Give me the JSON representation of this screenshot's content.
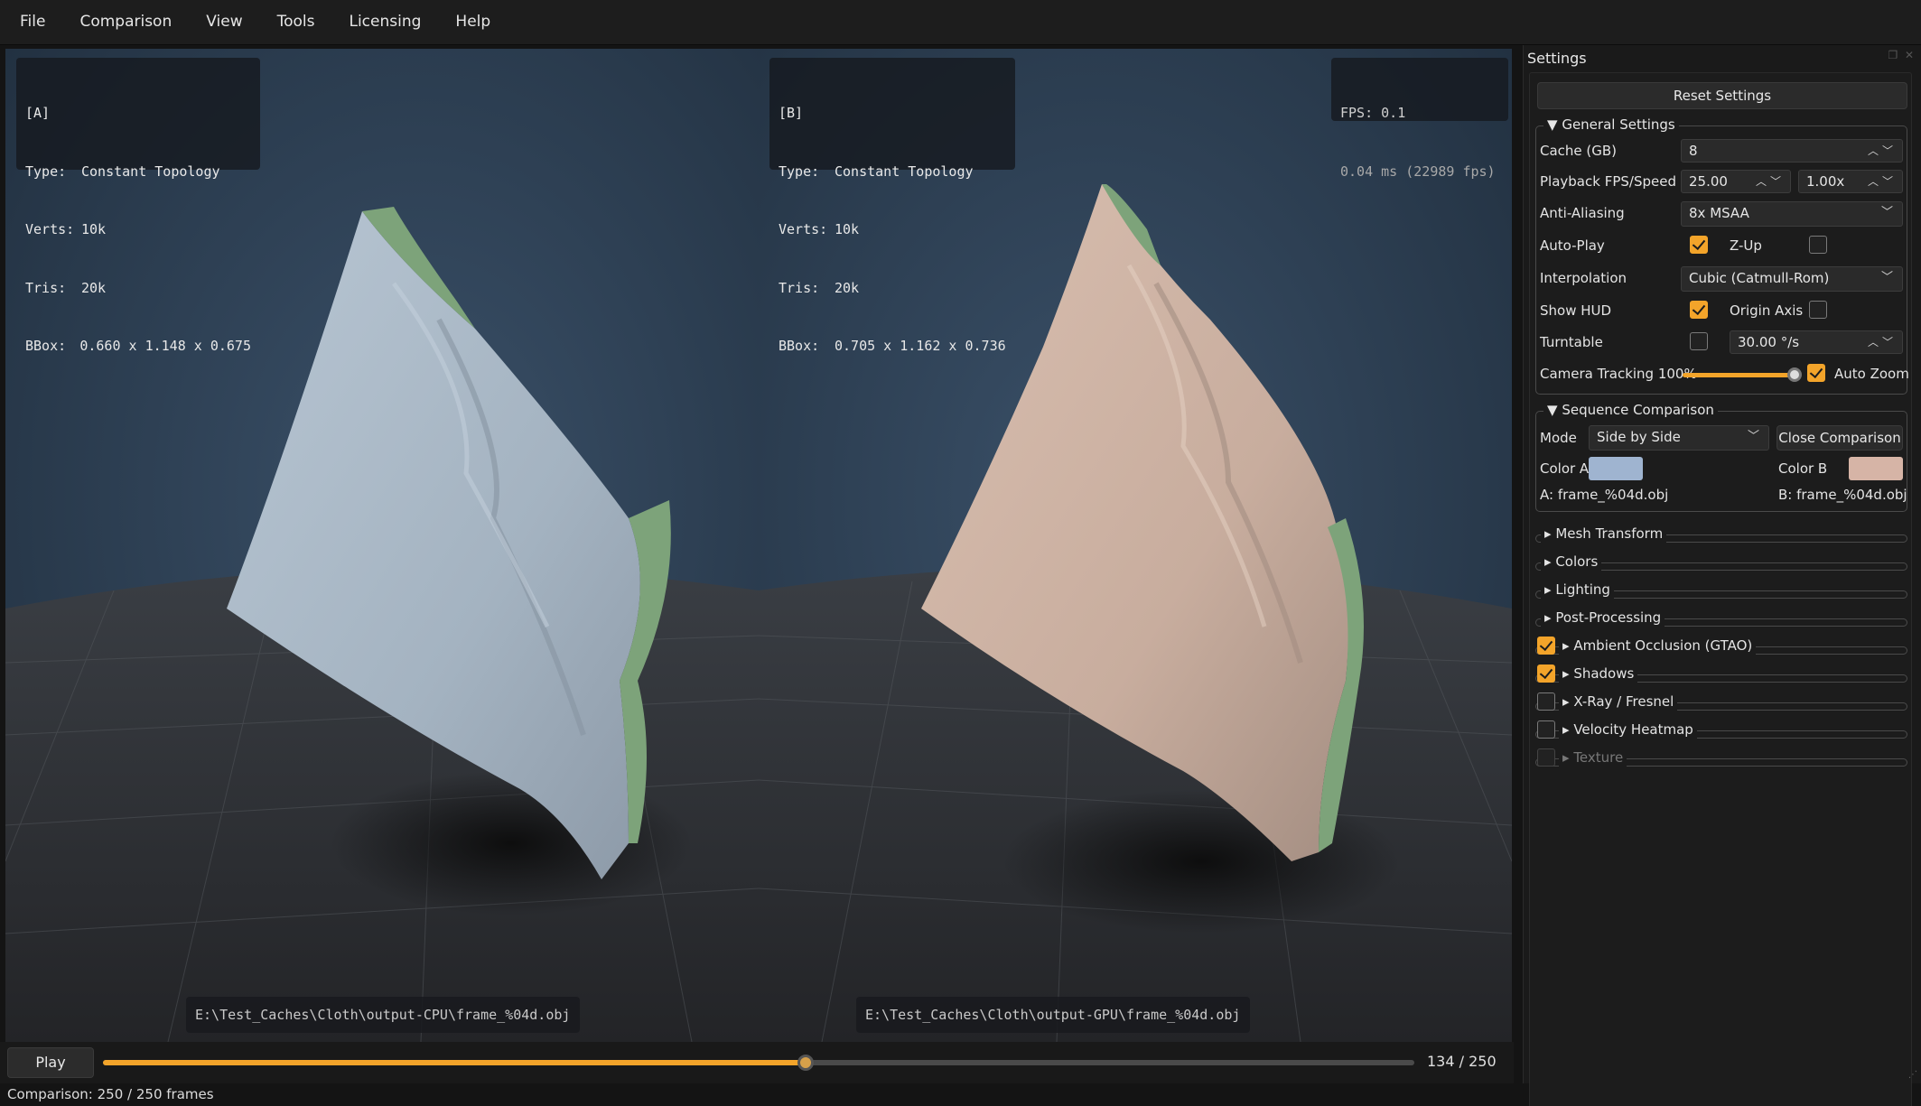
{
  "menubar": {
    "items": [
      "File",
      "Comparison",
      "View",
      "Tools",
      "Licensing",
      "Help"
    ]
  },
  "viewport": {
    "hud_a": {
      "tag": "[A]",
      "type_label": "Type:",
      "type": "Constant Topology",
      "verts_label": "Verts:",
      "verts": "10k",
      "tris_label": "Tris:",
      "tris": "20k",
      "bbox_label": "BBox:",
      "bbox": "0.660 x 1.148 x 0.675"
    },
    "hud_b": {
      "tag": "[B]",
      "type_label": "Type:",
      "type": "Constant Topology",
      "verts_label": "Verts:",
      "verts": "10k",
      "tris_label": "Tris:",
      "tris": "20k",
      "bbox_label": "BBox:",
      "bbox": "0.705 x 1.162 x 0.736"
    },
    "fps": {
      "line1": "FPS: 0.1",
      "line2": "0.04 ms (22989 fps)"
    },
    "path_a": "E:\\Test_Caches\\Cloth\\output-CPU\\frame_%04d.obj",
    "path_b": "E:\\Test_Caches\\Cloth\\output-GPU\\frame_%04d.obj",
    "colors": {
      "cloth_a": "#aab8c6",
      "cloth_b": "#c8ad9e",
      "backface": "#7da37a",
      "background": "#2d3f52",
      "floor": "#3a3c3f"
    }
  },
  "playback": {
    "play_label": "Play",
    "frame_label": "134 / 250",
    "progress": 0.536,
    "accent": "#f3a42a"
  },
  "status": {
    "text": "Comparison: 250 / 250 frames"
  },
  "settings": {
    "title": "Settings",
    "reset_label": "Reset Settings",
    "general": {
      "title": "General Settings",
      "cache_label": "Cache (GB)",
      "cache_value": "8",
      "playback_label": "Playback FPS/Speed",
      "fps_value": "25.00",
      "speed_value": "1.00x",
      "aa_label": "Anti-Aliasing",
      "aa_value": "8x MSAA",
      "autoplay_label": "Auto-Play",
      "autoplay": true,
      "zup_label": "Z-Up",
      "zup": false,
      "interp_label": "Interpolation",
      "interp_value": "Cubic (Catmull-Rom)",
      "hud_label": "Show HUD",
      "hud": true,
      "origin_label": "Origin Axis",
      "origin": false,
      "turntable_label": "Turntable",
      "turntable": false,
      "turntable_value": "30.00 °/s",
      "tracking_label": "Camera Tracking 100%",
      "tracking": 1.0,
      "autozoom_label": "Auto Zoom",
      "autozoom": true
    },
    "sequence": {
      "title": "Sequence Comparison",
      "mode_label": "Mode",
      "mode_value": "Side by Side",
      "close_label": "Close Comparison",
      "color_a_label": "Color A",
      "color_a": "#9fb4d0",
      "color_b_label": "Color B",
      "color_b": "#d6b4a6",
      "file_a": "A: frame_%04d.obj",
      "file_b": "B: frame_%04d.obj"
    },
    "sections": [
      "Mesh Transform",
      "Colors",
      "Lighting",
      "Post-Processing"
    ],
    "effects": [
      {
        "label": "Ambient Occlusion (GTAO)",
        "enabled": true
      },
      {
        "label": "Shadows",
        "enabled": true
      },
      {
        "label": "X-Ray / Fresnel",
        "enabled": false
      },
      {
        "label": "Velocity Heatmap",
        "enabled": false
      },
      {
        "label": "Texture",
        "enabled": false,
        "disabled": true
      }
    ]
  }
}
